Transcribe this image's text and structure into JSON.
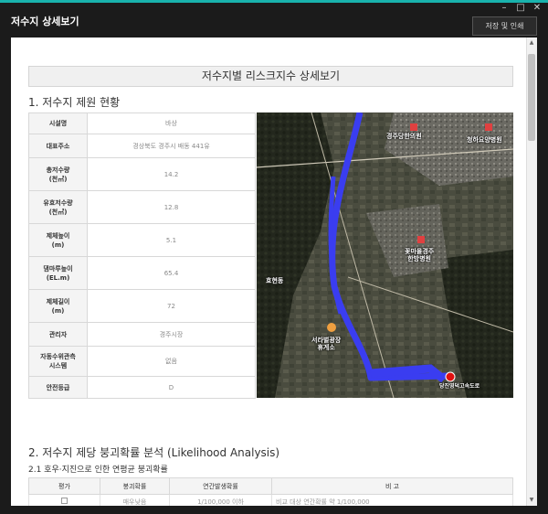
{
  "window": {
    "title": "저수지 상세보기",
    "controls": [
      "–",
      "□",
      "✕"
    ],
    "print_button": "저장 및 인쇄"
  },
  "page": {
    "header": "저수지별 리스크지수 상세보기",
    "section1_title": "1. 저수지 제원 현황",
    "section2_title": "2. 저수지 제당 붕괴확률 분석 (Likelihood Analysis)",
    "section2_sub": "2.1 호우·지진으로 인한 연평균 붕괴확률"
  },
  "info_table": [
    {
      "label": "시설명",
      "value": "바상"
    },
    {
      "label": "대표주소",
      "value": "경상북도 경주시 배동 441유"
    },
    {
      "label": "총저수량\n(천㎥)",
      "value": "14.2"
    },
    {
      "label": "유효저수량\n(천㎥)",
      "value": "12.8"
    },
    {
      "label": "제체높이\n(m)",
      "value": "5.1"
    },
    {
      "label": "댐마루높이\n(EL.m)",
      "value": "65.4"
    },
    {
      "label": "제체길이\n(m)",
      "value": "72"
    },
    {
      "label": "관리자",
      "value": "경주시장"
    },
    {
      "label": "자동수위관측\n시스템",
      "value": "없음"
    },
    {
      "label": "안전등급",
      "value": "D"
    }
  ],
  "map": {
    "labels": {
      "hospital1": "경주당한의원",
      "hospital2": "청하요양병원",
      "hospital3": "꽃마을경주\n한방병원",
      "place1": "효현동",
      "place2": "서라벌광장\n휴게소",
      "road": "당진영덕고속도로"
    },
    "colors": {
      "river": "#3a3df0",
      "marker": "#e01010"
    }
  },
  "analysis_table": {
    "headers": [
      "평가",
      "붕괴확률",
      "연간발생확률",
      "비 고"
    ],
    "rows": [
      {
        "grade": "매우낮음",
        "prob": "1/100,000 이하",
        "note": "비교 대상 연간확률 약 1/100,000"
      }
    ]
  }
}
